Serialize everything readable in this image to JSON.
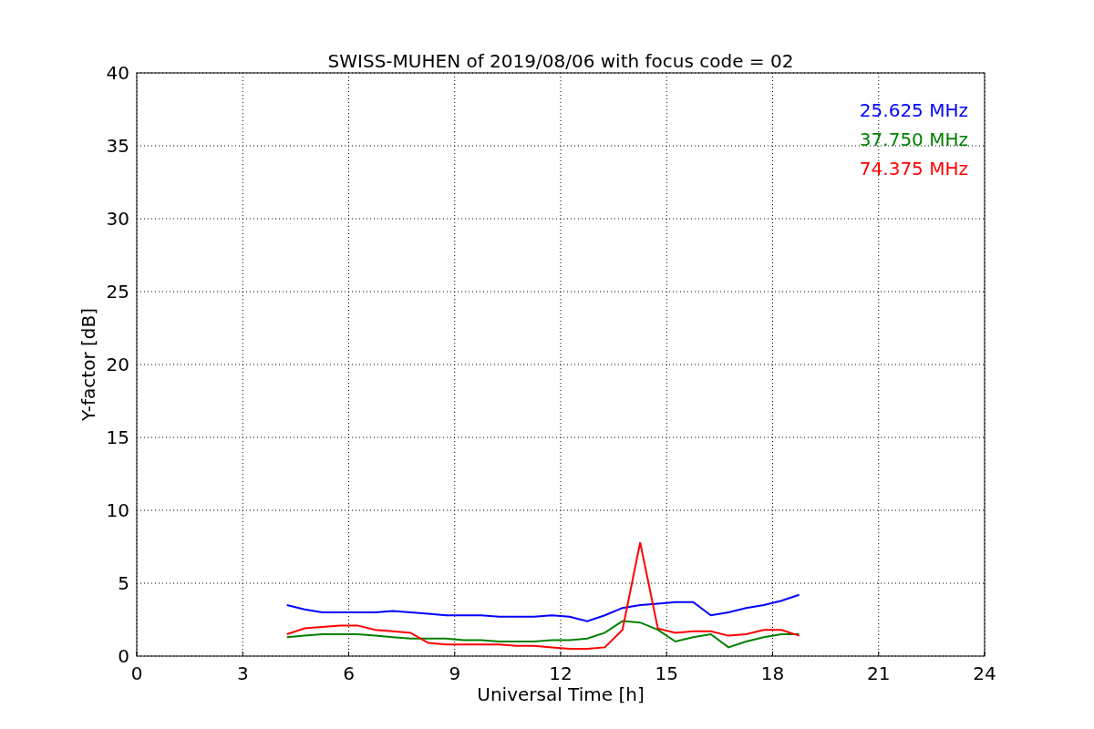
{
  "chart_data": {
    "type": "line",
    "title": "SWISS-MUHEN of 2019/08/06 with focus code = 02",
    "xlabel": "Universal Time [h]",
    "ylabel": "Y-factor [dB]",
    "x": [
      4.25,
      4.75,
      5.25,
      5.75,
      6.25,
      6.75,
      7.25,
      7.75,
      8.25,
      8.75,
      9.25,
      9.75,
      10.25,
      10.75,
      11.25,
      11.75,
      12.25,
      12.75,
      13.25,
      13.75,
      14.25,
      14.75,
      15.25,
      15.75,
      16.25,
      16.75,
      17.25,
      17.75,
      18.25,
      18.75
    ],
    "series": [
      {
        "name": "25.625 MHz",
        "color": "#0000ff",
        "values": [
          3.5,
          3.2,
          3.0,
          3.0,
          3.0,
          3.0,
          3.1,
          3.0,
          2.9,
          2.8,
          2.8,
          2.8,
          2.7,
          2.7,
          2.7,
          2.8,
          2.7,
          2.4,
          2.8,
          3.3,
          3.5,
          3.6,
          3.7,
          3.7,
          2.8,
          3.0,
          3.3,
          3.5,
          3.8,
          4.2
        ]
      },
      {
        "name": "37.750 MHz",
        "color": "#008000",
        "values": [
          1.3,
          1.4,
          1.5,
          1.5,
          1.5,
          1.4,
          1.3,
          1.2,
          1.2,
          1.2,
          1.1,
          1.1,
          1.0,
          1.0,
          1.0,
          1.1,
          1.1,
          1.2,
          1.6,
          2.4,
          2.3,
          1.8,
          1.0,
          1.3,
          1.5,
          0.6,
          1.0,
          1.3,
          1.5,
          1.5
        ]
      },
      {
        "name": "74.375 MHz",
        "color": "#ff0000",
        "values": [
          1.5,
          1.9,
          2.0,
          2.1,
          2.1,
          1.8,
          1.7,
          1.6,
          0.9,
          0.8,
          0.8,
          0.8,
          0.8,
          0.7,
          0.7,
          0.6,
          0.5,
          0.5,
          0.6,
          1.8,
          7.8,
          1.9,
          1.6,
          1.7,
          1.7,
          1.4,
          1.5,
          1.8,
          1.8,
          1.4
        ]
      }
    ],
    "grid": true,
    "xlim": [
      0,
      24
    ],
    "ylim": [
      0,
      40
    ],
    "xticks": [
      0,
      3,
      6,
      9,
      12,
      15,
      18,
      21,
      24
    ],
    "yticks": [
      0,
      5,
      10,
      15,
      20,
      25,
      30,
      35,
      40
    ]
  }
}
